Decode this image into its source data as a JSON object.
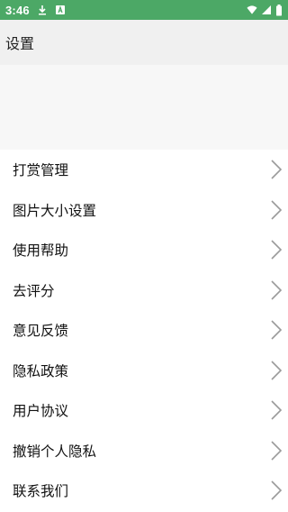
{
  "status_bar": {
    "time": "3:46",
    "icons": [
      "download-icon",
      "app-notification-icon",
      "wifi-icon",
      "cellular-signal-icon",
      "battery-icon"
    ]
  },
  "app_bar": {
    "title": "设置"
  },
  "menu": {
    "items": [
      {
        "label": "打赏管理"
      },
      {
        "label": "图片大小设置"
      },
      {
        "label": "使用帮助"
      },
      {
        "label": "去评分"
      },
      {
        "label": "意见反馈"
      },
      {
        "label": "隐私政策"
      },
      {
        "label": "用户协议"
      },
      {
        "label": "撤销个人隐私"
      },
      {
        "label": "联系我们"
      }
    ]
  },
  "colors": {
    "status_bar": "#4ca866",
    "app_bar": "#f0f0f0",
    "chevron": "#9a9a9a"
  }
}
